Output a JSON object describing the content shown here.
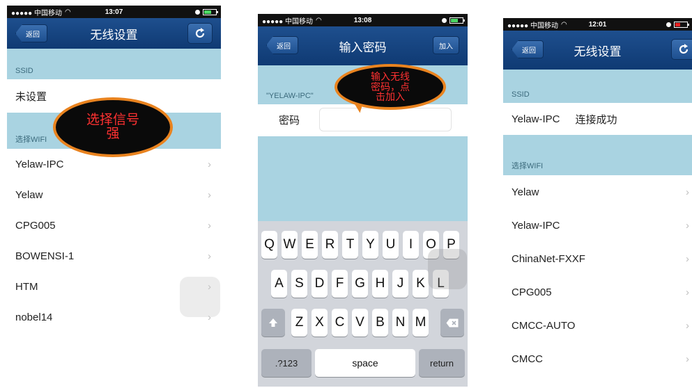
{
  "status": {
    "carrier": "●●●●● 中国移动",
    "times": [
      "13:07",
      "13:08",
      "12:01"
    ],
    "icons": [
      "wifi-icon",
      "location-icon",
      "battery-icon"
    ]
  },
  "screen1": {
    "back": "返回",
    "title": "无线设置",
    "ssid_header": "SSID",
    "ssid_value": "未设置",
    "wifi_header": "选择WIFI",
    "networks": [
      "Yelaw-IPC",
      "Yelaw",
      "CPG005",
      "BOWENSI-1",
      "HTM",
      "nobel14"
    ],
    "bubble": "选择信号强"
  },
  "screen2": {
    "back": "返回",
    "title": "输入密码",
    "join": "加入",
    "network_header": "\"YELAW-IPC\"",
    "pw_label": "密码",
    "pw_value": "",
    "bubble": "输入无线密码，点击加入",
    "keys_row1": [
      "Q",
      "W",
      "E",
      "R",
      "T",
      "Y",
      "U",
      "I",
      "O",
      "P"
    ],
    "keys_row2": [
      "A",
      "S",
      "D",
      "F",
      "G",
      "H",
      "J",
      "K",
      "L"
    ],
    "keys_row3": [
      "Z",
      "X",
      "C",
      "V",
      "B",
      "N",
      "M"
    ],
    "key_num": ".?123",
    "key_space": "space",
    "key_return": "return"
  },
  "screen3": {
    "back": "返回",
    "title": "无线设置",
    "ssid_header": "SSID",
    "ssid_value": "Yelaw-IPC",
    "ssid_status": "连接成功",
    "wifi_header": "选择WIFI",
    "networks": [
      "Yelaw",
      "Yelaw-IPC",
      "ChinaNet-FXXF",
      "CPG005",
      "CMCC-AUTO",
      "CMCC"
    ]
  },
  "colors": {
    "nav": "#1e4f8e",
    "section": "#a9d3e1",
    "bubble_border": "#e9831f",
    "bubble_text": "#ff3131"
  }
}
